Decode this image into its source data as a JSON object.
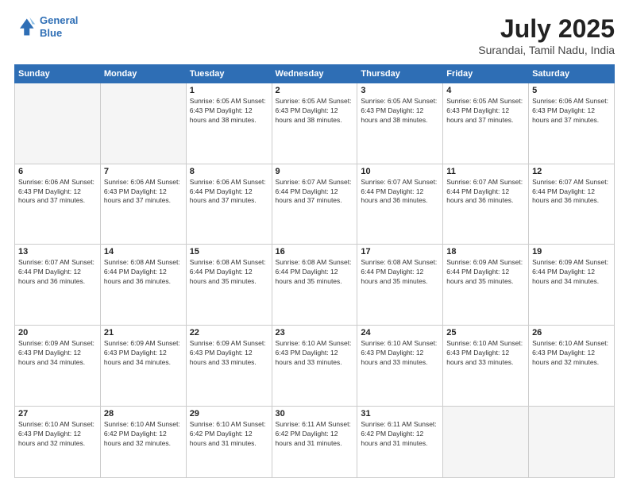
{
  "logo": {
    "line1": "General",
    "line2": "Blue"
  },
  "title": "July 2025",
  "subtitle": "Surandai, Tamil Nadu, India",
  "days_header": [
    "Sunday",
    "Monday",
    "Tuesday",
    "Wednesday",
    "Thursday",
    "Friday",
    "Saturday"
  ],
  "weeks": [
    [
      {
        "day": "",
        "info": ""
      },
      {
        "day": "",
        "info": ""
      },
      {
        "day": "1",
        "info": "Sunrise: 6:05 AM\nSunset: 6:43 PM\nDaylight: 12 hours\nand 38 minutes."
      },
      {
        "day": "2",
        "info": "Sunrise: 6:05 AM\nSunset: 6:43 PM\nDaylight: 12 hours\nand 38 minutes."
      },
      {
        "day": "3",
        "info": "Sunrise: 6:05 AM\nSunset: 6:43 PM\nDaylight: 12 hours\nand 38 minutes."
      },
      {
        "day": "4",
        "info": "Sunrise: 6:05 AM\nSunset: 6:43 PM\nDaylight: 12 hours\nand 37 minutes."
      },
      {
        "day": "5",
        "info": "Sunrise: 6:06 AM\nSunset: 6:43 PM\nDaylight: 12 hours\nand 37 minutes."
      }
    ],
    [
      {
        "day": "6",
        "info": "Sunrise: 6:06 AM\nSunset: 6:43 PM\nDaylight: 12 hours\nand 37 minutes."
      },
      {
        "day": "7",
        "info": "Sunrise: 6:06 AM\nSunset: 6:43 PM\nDaylight: 12 hours\nand 37 minutes."
      },
      {
        "day": "8",
        "info": "Sunrise: 6:06 AM\nSunset: 6:44 PM\nDaylight: 12 hours\nand 37 minutes."
      },
      {
        "day": "9",
        "info": "Sunrise: 6:07 AM\nSunset: 6:44 PM\nDaylight: 12 hours\nand 37 minutes."
      },
      {
        "day": "10",
        "info": "Sunrise: 6:07 AM\nSunset: 6:44 PM\nDaylight: 12 hours\nand 36 minutes."
      },
      {
        "day": "11",
        "info": "Sunrise: 6:07 AM\nSunset: 6:44 PM\nDaylight: 12 hours\nand 36 minutes."
      },
      {
        "day": "12",
        "info": "Sunrise: 6:07 AM\nSunset: 6:44 PM\nDaylight: 12 hours\nand 36 minutes."
      }
    ],
    [
      {
        "day": "13",
        "info": "Sunrise: 6:07 AM\nSunset: 6:44 PM\nDaylight: 12 hours\nand 36 minutes."
      },
      {
        "day": "14",
        "info": "Sunrise: 6:08 AM\nSunset: 6:44 PM\nDaylight: 12 hours\nand 36 minutes."
      },
      {
        "day": "15",
        "info": "Sunrise: 6:08 AM\nSunset: 6:44 PM\nDaylight: 12 hours\nand 35 minutes."
      },
      {
        "day": "16",
        "info": "Sunrise: 6:08 AM\nSunset: 6:44 PM\nDaylight: 12 hours\nand 35 minutes."
      },
      {
        "day": "17",
        "info": "Sunrise: 6:08 AM\nSunset: 6:44 PM\nDaylight: 12 hours\nand 35 minutes."
      },
      {
        "day": "18",
        "info": "Sunrise: 6:09 AM\nSunset: 6:44 PM\nDaylight: 12 hours\nand 35 minutes."
      },
      {
        "day": "19",
        "info": "Sunrise: 6:09 AM\nSunset: 6:44 PM\nDaylight: 12 hours\nand 34 minutes."
      }
    ],
    [
      {
        "day": "20",
        "info": "Sunrise: 6:09 AM\nSunset: 6:43 PM\nDaylight: 12 hours\nand 34 minutes."
      },
      {
        "day": "21",
        "info": "Sunrise: 6:09 AM\nSunset: 6:43 PM\nDaylight: 12 hours\nand 34 minutes."
      },
      {
        "day": "22",
        "info": "Sunrise: 6:09 AM\nSunset: 6:43 PM\nDaylight: 12 hours\nand 33 minutes."
      },
      {
        "day": "23",
        "info": "Sunrise: 6:10 AM\nSunset: 6:43 PM\nDaylight: 12 hours\nand 33 minutes."
      },
      {
        "day": "24",
        "info": "Sunrise: 6:10 AM\nSunset: 6:43 PM\nDaylight: 12 hours\nand 33 minutes."
      },
      {
        "day": "25",
        "info": "Sunrise: 6:10 AM\nSunset: 6:43 PM\nDaylight: 12 hours\nand 33 minutes."
      },
      {
        "day": "26",
        "info": "Sunrise: 6:10 AM\nSunset: 6:43 PM\nDaylight: 12 hours\nand 32 minutes."
      }
    ],
    [
      {
        "day": "27",
        "info": "Sunrise: 6:10 AM\nSunset: 6:43 PM\nDaylight: 12 hours\nand 32 minutes."
      },
      {
        "day": "28",
        "info": "Sunrise: 6:10 AM\nSunset: 6:42 PM\nDaylight: 12 hours\nand 32 minutes."
      },
      {
        "day": "29",
        "info": "Sunrise: 6:10 AM\nSunset: 6:42 PM\nDaylight: 12 hours\nand 31 minutes."
      },
      {
        "day": "30",
        "info": "Sunrise: 6:11 AM\nSunset: 6:42 PM\nDaylight: 12 hours\nand 31 minutes."
      },
      {
        "day": "31",
        "info": "Sunrise: 6:11 AM\nSunset: 6:42 PM\nDaylight: 12 hours\nand 31 minutes."
      },
      {
        "day": "",
        "info": ""
      },
      {
        "day": "",
        "info": ""
      }
    ]
  ]
}
